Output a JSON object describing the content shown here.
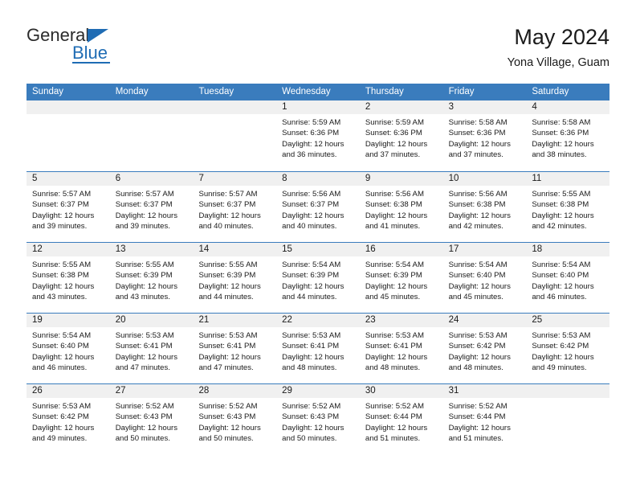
{
  "logo": {
    "primary_text": "General",
    "secondary_text": "Blue",
    "brand_color": "#1f6cb4",
    "triangle_icon": "triangle-icon"
  },
  "header": {
    "title": "May 2024",
    "subtitle": "Yona Village, Guam"
  },
  "calendar": {
    "header_bg": "#3a7cbd",
    "daynum_bg": "#f0f0f0",
    "weekdays": [
      "Sunday",
      "Monday",
      "Tuesday",
      "Wednesday",
      "Thursday",
      "Friday",
      "Saturday"
    ],
    "weeks": [
      [
        {
          "day": "",
          "empty": true,
          "lines": []
        },
        {
          "day": "",
          "empty": true,
          "lines": []
        },
        {
          "day": "",
          "empty": true,
          "lines": []
        },
        {
          "day": "1",
          "empty": false,
          "lines": [
            "Sunrise: 5:59 AM",
            "Sunset: 6:36 PM",
            "Daylight: 12 hours",
            "and 36 minutes."
          ]
        },
        {
          "day": "2",
          "empty": false,
          "lines": [
            "Sunrise: 5:59 AM",
            "Sunset: 6:36 PM",
            "Daylight: 12 hours",
            "and 37 minutes."
          ]
        },
        {
          "day": "3",
          "empty": false,
          "lines": [
            "Sunrise: 5:58 AM",
            "Sunset: 6:36 PM",
            "Daylight: 12 hours",
            "and 37 minutes."
          ]
        },
        {
          "day": "4",
          "empty": false,
          "lines": [
            "Sunrise: 5:58 AM",
            "Sunset: 6:36 PM",
            "Daylight: 12 hours",
            "and 38 minutes."
          ]
        }
      ],
      [
        {
          "day": "5",
          "empty": false,
          "lines": [
            "Sunrise: 5:57 AM",
            "Sunset: 6:37 PM",
            "Daylight: 12 hours",
            "and 39 minutes."
          ]
        },
        {
          "day": "6",
          "empty": false,
          "lines": [
            "Sunrise: 5:57 AM",
            "Sunset: 6:37 PM",
            "Daylight: 12 hours",
            "and 39 minutes."
          ]
        },
        {
          "day": "7",
          "empty": false,
          "lines": [
            "Sunrise: 5:57 AM",
            "Sunset: 6:37 PM",
            "Daylight: 12 hours",
            "and 40 minutes."
          ]
        },
        {
          "day": "8",
          "empty": false,
          "lines": [
            "Sunrise: 5:56 AM",
            "Sunset: 6:37 PM",
            "Daylight: 12 hours",
            "and 40 minutes."
          ]
        },
        {
          "day": "9",
          "empty": false,
          "lines": [
            "Sunrise: 5:56 AM",
            "Sunset: 6:38 PM",
            "Daylight: 12 hours",
            "and 41 minutes."
          ]
        },
        {
          "day": "10",
          "empty": false,
          "lines": [
            "Sunrise: 5:56 AM",
            "Sunset: 6:38 PM",
            "Daylight: 12 hours",
            "and 42 minutes."
          ]
        },
        {
          "day": "11",
          "empty": false,
          "lines": [
            "Sunrise: 5:55 AM",
            "Sunset: 6:38 PM",
            "Daylight: 12 hours",
            "and 42 minutes."
          ]
        }
      ],
      [
        {
          "day": "12",
          "empty": false,
          "lines": [
            "Sunrise: 5:55 AM",
            "Sunset: 6:38 PM",
            "Daylight: 12 hours",
            "and 43 minutes."
          ]
        },
        {
          "day": "13",
          "empty": false,
          "lines": [
            "Sunrise: 5:55 AM",
            "Sunset: 6:39 PM",
            "Daylight: 12 hours",
            "and 43 minutes."
          ]
        },
        {
          "day": "14",
          "empty": false,
          "lines": [
            "Sunrise: 5:55 AM",
            "Sunset: 6:39 PM",
            "Daylight: 12 hours",
            "and 44 minutes."
          ]
        },
        {
          "day": "15",
          "empty": false,
          "lines": [
            "Sunrise: 5:54 AM",
            "Sunset: 6:39 PM",
            "Daylight: 12 hours",
            "and 44 minutes."
          ]
        },
        {
          "day": "16",
          "empty": false,
          "lines": [
            "Sunrise: 5:54 AM",
            "Sunset: 6:39 PM",
            "Daylight: 12 hours",
            "and 45 minutes."
          ]
        },
        {
          "day": "17",
          "empty": false,
          "lines": [
            "Sunrise: 5:54 AM",
            "Sunset: 6:40 PM",
            "Daylight: 12 hours",
            "and 45 minutes."
          ]
        },
        {
          "day": "18",
          "empty": false,
          "lines": [
            "Sunrise: 5:54 AM",
            "Sunset: 6:40 PM",
            "Daylight: 12 hours",
            "and 46 minutes."
          ]
        }
      ],
      [
        {
          "day": "19",
          "empty": false,
          "lines": [
            "Sunrise: 5:54 AM",
            "Sunset: 6:40 PM",
            "Daylight: 12 hours",
            "and 46 minutes."
          ]
        },
        {
          "day": "20",
          "empty": false,
          "lines": [
            "Sunrise: 5:53 AM",
            "Sunset: 6:41 PM",
            "Daylight: 12 hours",
            "and 47 minutes."
          ]
        },
        {
          "day": "21",
          "empty": false,
          "lines": [
            "Sunrise: 5:53 AM",
            "Sunset: 6:41 PM",
            "Daylight: 12 hours",
            "and 47 minutes."
          ]
        },
        {
          "day": "22",
          "empty": false,
          "lines": [
            "Sunrise: 5:53 AM",
            "Sunset: 6:41 PM",
            "Daylight: 12 hours",
            "and 48 minutes."
          ]
        },
        {
          "day": "23",
          "empty": false,
          "lines": [
            "Sunrise: 5:53 AM",
            "Sunset: 6:41 PM",
            "Daylight: 12 hours",
            "and 48 minutes."
          ]
        },
        {
          "day": "24",
          "empty": false,
          "lines": [
            "Sunrise: 5:53 AM",
            "Sunset: 6:42 PM",
            "Daylight: 12 hours",
            "and 48 minutes."
          ]
        },
        {
          "day": "25",
          "empty": false,
          "lines": [
            "Sunrise: 5:53 AM",
            "Sunset: 6:42 PM",
            "Daylight: 12 hours",
            "and 49 minutes."
          ]
        }
      ],
      [
        {
          "day": "26",
          "empty": false,
          "lines": [
            "Sunrise: 5:53 AM",
            "Sunset: 6:42 PM",
            "Daylight: 12 hours",
            "and 49 minutes."
          ]
        },
        {
          "day": "27",
          "empty": false,
          "lines": [
            "Sunrise: 5:52 AM",
            "Sunset: 6:43 PM",
            "Daylight: 12 hours",
            "and 50 minutes."
          ]
        },
        {
          "day": "28",
          "empty": false,
          "lines": [
            "Sunrise: 5:52 AM",
            "Sunset: 6:43 PM",
            "Daylight: 12 hours",
            "and 50 minutes."
          ]
        },
        {
          "day": "29",
          "empty": false,
          "lines": [
            "Sunrise: 5:52 AM",
            "Sunset: 6:43 PM",
            "Daylight: 12 hours",
            "and 50 minutes."
          ]
        },
        {
          "day": "30",
          "empty": false,
          "lines": [
            "Sunrise: 5:52 AM",
            "Sunset: 6:44 PM",
            "Daylight: 12 hours",
            "and 51 minutes."
          ]
        },
        {
          "day": "31",
          "empty": false,
          "lines": [
            "Sunrise: 5:52 AM",
            "Sunset: 6:44 PM",
            "Daylight: 12 hours",
            "and 51 minutes."
          ]
        },
        {
          "day": "",
          "empty": true,
          "lines": []
        }
      ]
    ]
  }
}
